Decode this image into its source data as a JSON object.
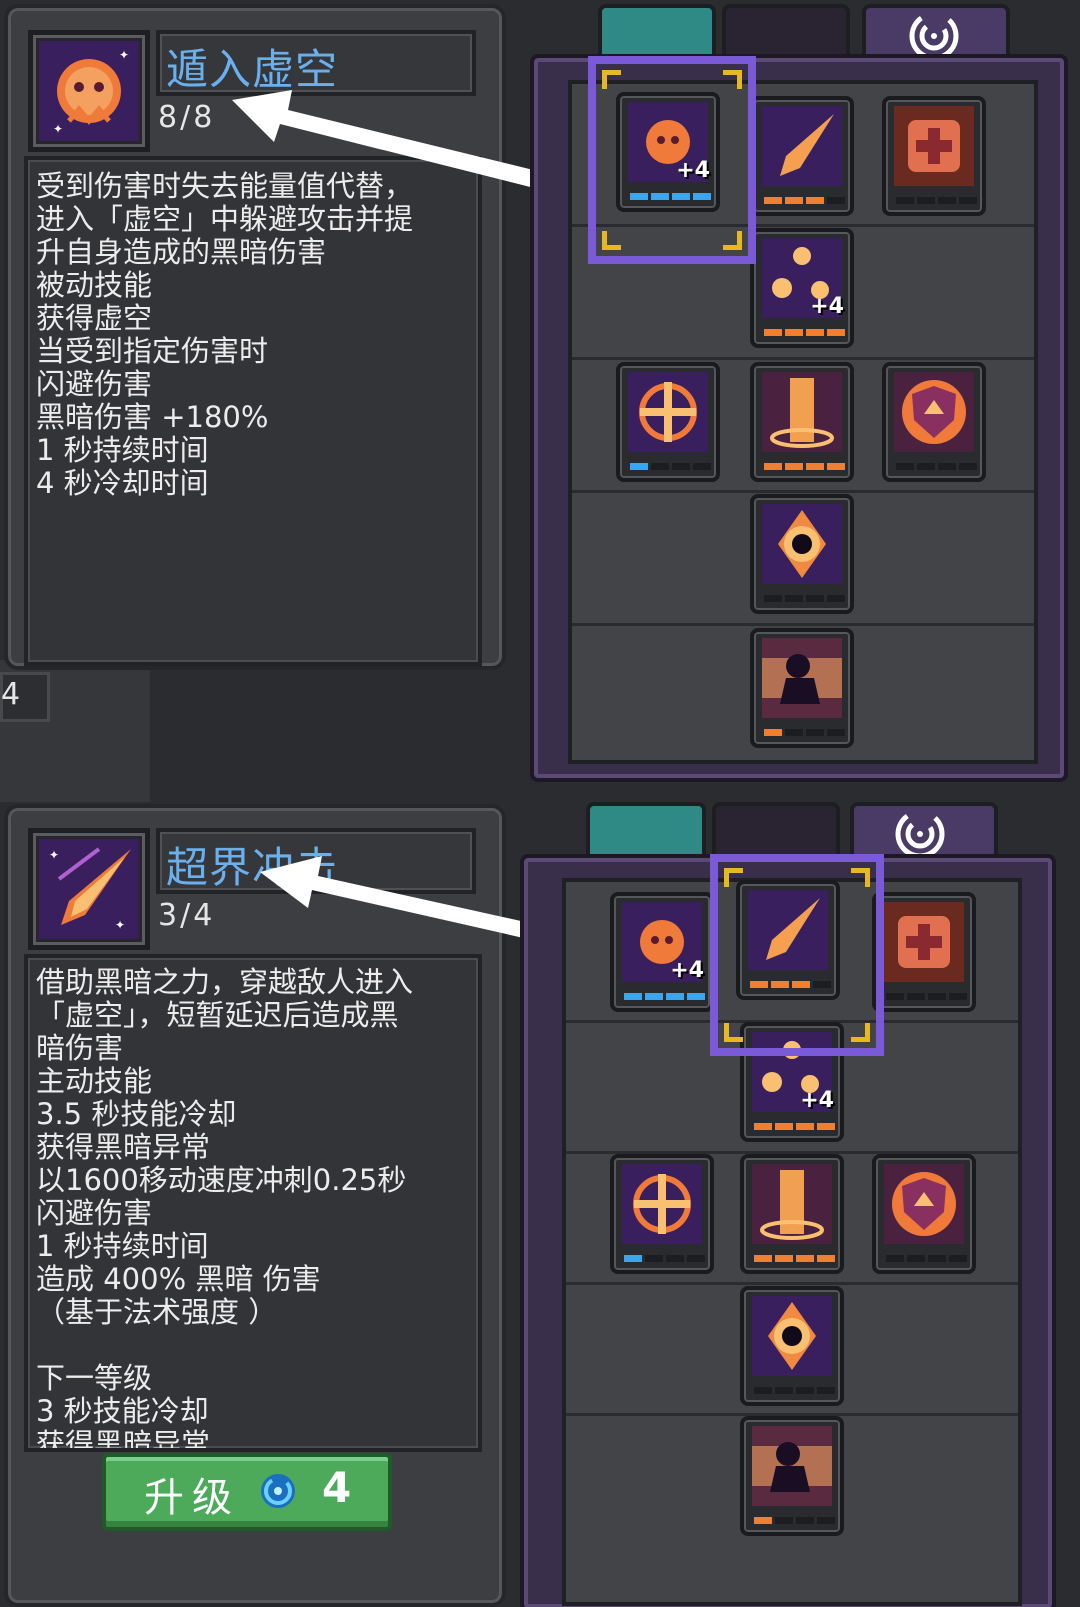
{
  "panel_top": {
    "skill_title": "遁入虚空",
    "skill_level": "8/8",
    "description_lines": [
      {
        "text": "受到伤害时失去能量值代替，",
        "color": "white"
      },
      {
        "text": "进入「虚空」中躲避攻击并提",
        "color": "white"
      },
      {
        "text": "升自身造成的黑暗伤害",
        "color": "white"
      },
      {
        "text": "被动技能",
        "color": "blue"
      },
      {
        "text": "获得虚空",
        "color": "white"
      },
      {
        "text": "当受到指定伤害时",
        "color": "white"
      },
      {
        "text": "闪避伤害",
        "color": "white"
      },
      {
        "text": "黑暗伤害 +180%",
        "color": "purple"
      },
      {
        "text": "1 秒持续时间",
        "color": "white"
      },
      {
        "text": "4 秒冷却时间",
        "color": "white"
      }
    ],
    "side_counter": "4"
  },
  "panel_bottom": {
    "skill_title": "超界冲击",
    "skill_level": "3/4",
    "description_lines": [
      {
        "text": "借助黑暗之力，穿越敌人进入",
        "color": "purple"
      },
      {
        "text": "「虚空」，短暂延迟后造成黑",
        "color": "white"
      },
      {
        "text": "暗伤害",
        "color": "white"
      },
      {
        "text": "主动技能",
        "color": "orange"
      },
      {
        "text": "3.5 秒技能冷却",
        "color": "green"
      },
      {
        "text": "获得黑暗异常",
        "color": "white"
      },
      {
        "text": "以1600移动速度冲刺0.25秒",
        "color": "white"
      },
      {
        "text": "闪避伤害",
        "color": "white"
      },
      {
        "text": "1 秒持续时间",
        "color": "white"
      },
      {
        "text": "造成 400% 黑暗 伤害",
        "color": "white"
      },
      {
        "text": "（基于法术强度 ）",
        "color": "white"
      },
      {
        "text": "",
        "color": "white"
      },
      {
        "text": "下一等级",
        "color": "blue"
      },
      {
        "text": "3 秒技能冷却",
        "color": "green"
      },
      {
        "text": "获得黑暗异常",
        "color": "white"
      }
    ],
    "upgrade_label": "升级",
    "upgrade_cost": "4"
  },
  "skill_tree": {
    "nodes": [
      {
        "name": "void-dodge",
        "bars": "4/4",
        "bar_color": "blue",
        "bonus": "+4"
      },
      {
        "name": "beyond-strike",
        "bars": "3/4",
        "bar_color": "orange",
        "bonus": ""
      },
      {
        "name": "heal-cross",
        "bars": "0/4",
        "bar_color": "none",
        "bonus": ""
      },
      {
        "name": "void-orbs",
        "bars": "4/4",
        "bar_color": "orange",
        "bonus": "+4"
      },
      {
        "name": "chain-seal",
        "bars": "1/4",
        "bar_color": "blue",
        "bonus": ""
      },
      {
        "name": "light-pillar",
        "bars": "4/4",
        "bar_color": "orange",
        "bonus": ""
      },
      {
        "name": "shield-up",
        "bars": "0/4",
        "bar_color": "none",
        "bonus": ""
      },
      {
        "name": "black-hole",
        "bars": "0/4",
        "bar_color": "none",
        "bonus": ""
      },
      {
        "name": "shadow-figure",
        "bars": "1/4",
        "bar_color": "orange",
        "bonus": ""
      }
    ]
  }
}
